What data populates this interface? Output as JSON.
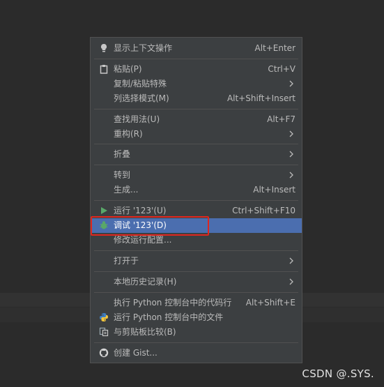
{
  "menu": {
    "items": [
      {
        "label": "显示上下文操作",
        "shortcut": "Alt+Enter"
      },
      {
        "label": "粘贴(P)",
        "shortcut": "Ctrl+V"
      },
      {
        "label": "复制/粘贴特殊",
        "shortcut": ""
      },
      {
        "label": "列选择模式(M)",
        "shortcut": "Alt+Shift+Insert"
      },
      {
        "label": "查找用法(U)",
        "shortcut": "Alt+F7"
      },
      {
        "label": "重构(R)",
        "shortcut": ""
      },
      {
        "label": "折叠",
        "shortcut": ""
      },
      {
        "label": "转到",
        "shortcut": ""
      },
      {
        "label": "生成...",
        "shortcut": "Alt+Insert"
      },
      {
        "label": "运行 '123'(U)",
        "shortcut": "Ctrl+Shift+F10"
      },
      {
        "label": "调试 '123'(D)",
        "shortcut": ""
      },
      {
        "label": "修改运行配置...",
        "shortcut": ""
      },
      {
        "label": "打开于",
        "shortcut": ""
      },
      {
        "label": "本地历史记录(H)",
        "shortcut": ""
      },
      {
        "label": "执行 Python 控制台中的代码行",
        "shortcut": "Alt+Shift+E"
      },
      {
        "label": "运行 Python 控制台中的文件",
        "shortcut": ""
      },
      {
        "label": "与剪贴板比较(B)",
        "shortcut": ""
      },
      {
        "label": "创建 Gist...",
        "shortcut": ""
      }
    ],
    "highlighted_item": "调试 '123'(D)",
    "colors": {
      "menu_bg": "#3c3f41",
      "highlight": "#4b6eaf",
      "run_icon": "#59a869",
      "debug_icon": "#59a869",
      "annotation": "#e0261e"
    }
  },
  "watermark": "CSDN @.SYS."
}
